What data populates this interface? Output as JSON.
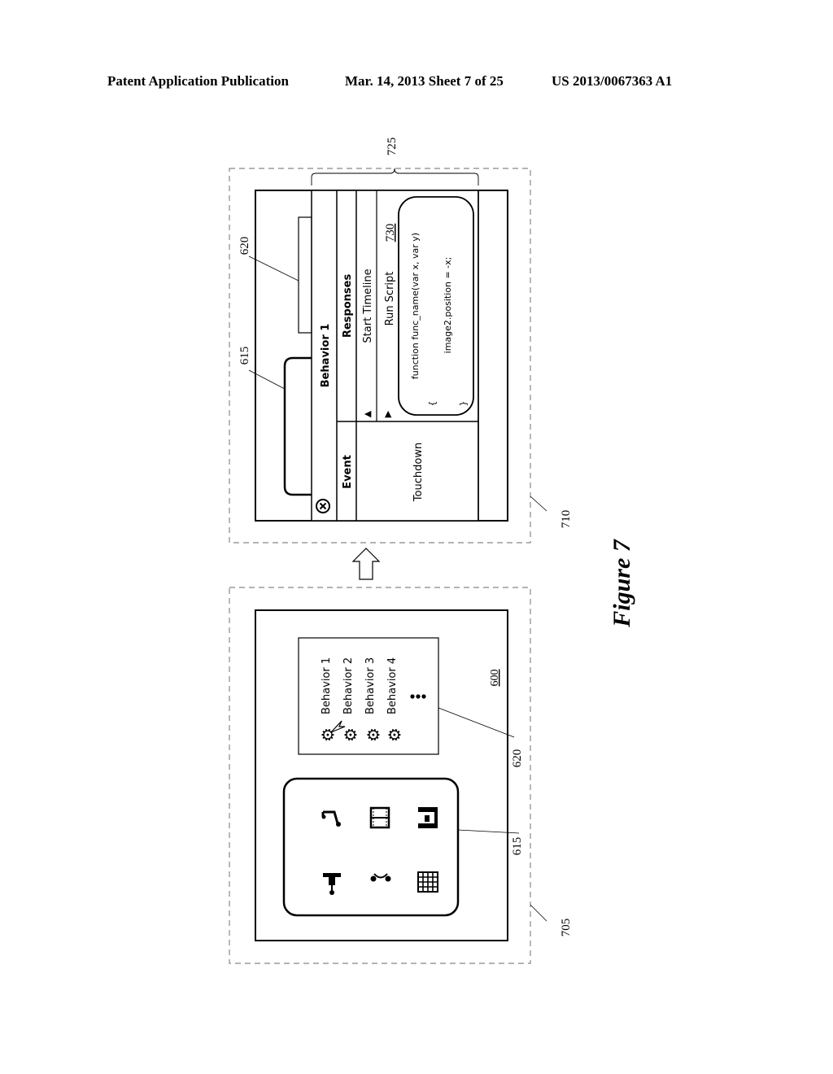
{
  "header": {
    "left": "Patent Application Publication",
    "center": "Mar. 14, 2013  Sheet 7 of 25",
    "right": "US 2013/0067363 A1"
  },
  "figure": {
    "caption": "Figure 7",
    "orientation": "rotated 90 degrees counter-clockwise",
    "stage_705": {
      "ref": "705",
      "screen_ref": "600",
      "library_ref": "615",
      "behaviors_ref": "620",
      "library_icons": [
        "sound-icon",
        "film-icon",
        "layout-icon",
        "pin-icon",
        "headphones-icon",
        "keypad-icon"
      ],
      "behaviors": [
        "Behavior 1",
        "Behavior 2",
        "Behavior 3",
        "Behavior 4"
      ],
      "ellipsis": "⋮"
    },
    "stage_710": {
      "ref": "710",
      "library_ref": "615",
      "behaviors_ref": "620",
      "panel_ref": "725",
      "script_ref": "730",
      "dialog": {
        "title": "Behavior 1",
        "close_glyph": "⊗",
        "event_header": "Event",
        "responses_header": "Responses",
        "event_value": "Touchdown",
        "responses": [
          {
            "arrow": "▲",
            "label": "Start Timeline"
          },
          {
            "arrow": "▶",
            "label": "Run Script"
          }
        ],
        "script_lines": [
          "function func_name(var x, var y)",
          "{",
          "image2.position = -x;",
          "}"
        ]
      }
    }
  }
}
